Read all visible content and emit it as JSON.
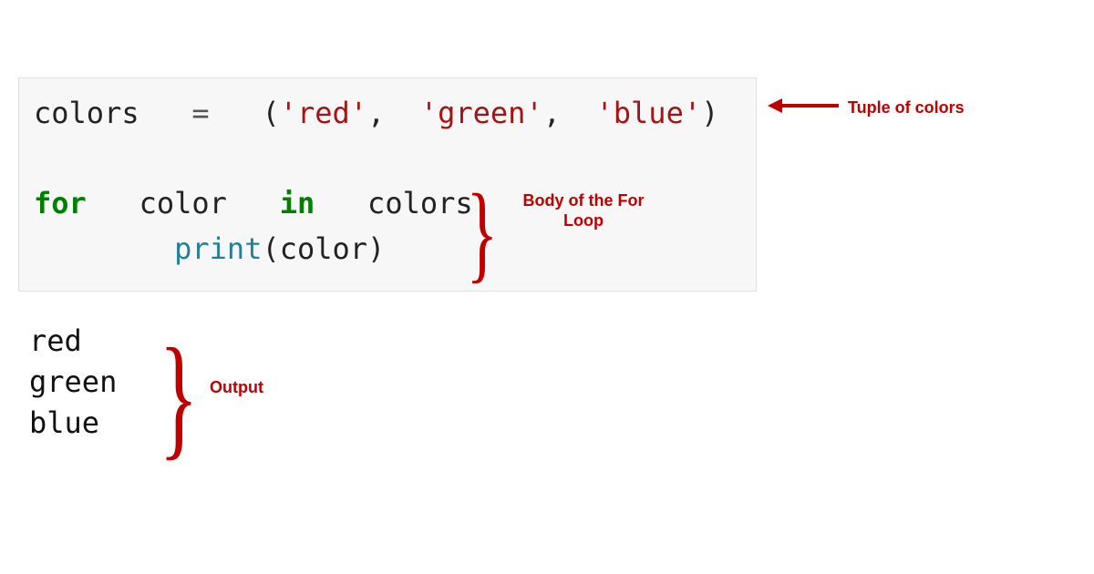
{
  "code": {
    "var": "colors",
    "assign": "=",
    "paren_open": "(",
    "str1": "'red'",
    "comma1": ",",
    "str2": "'green'",
    "comma2": ",",
    "str3": "'blue'",
    "paren_close": ")",
    "kw_for": "for",
    "loop_var": "color",
    "kw_in": "in",
    "iter_var": "colors",
    "colon": ":",
    "indent": "        ",
    "func": "print",
    "call_open": "(",
    "arg": "color",
    "call_close": ")"
  },
  "output": {
    "line1": "red",
    "line2": "green",
    "line3": "blue"
  },
  "annotations": {
    "tuple": "Tuple of colors",
    "body": "Body of the For Loop",
    "output": "Output"
  }
}
